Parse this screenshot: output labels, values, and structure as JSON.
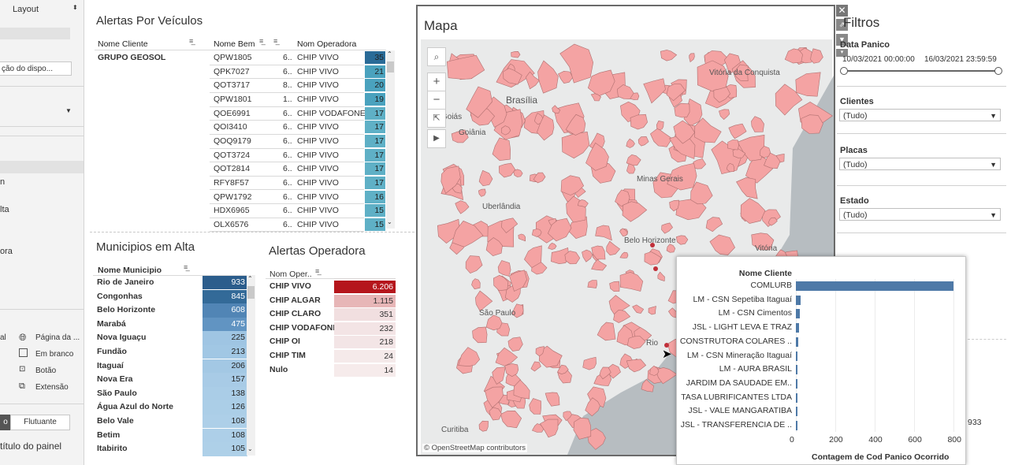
{
  "left_panel": {
    "layout_label": "Layout",
    "device_button": "ção do dispo...",
    "item_n": "n",
    "item_alta": "lta",
    "item_ora": "ora",
    "objects": [
      {
        "icon": "globe-icon",
        "label": "Página da ..."
      },
      {
        "icon": "blank-icon",
        "label": "Em branco"
      },
      {
        "icon": "button-icon",
        "label": "Botão"
      },
      {
        "icon": "extension-icon",
        "label": "Extensão"
      }
    ],
    "item_al": "al",
    "tiled_short": "o",
    "floating_label": "Flutuante",
    "panel_title": "título do painel"
  },
  "alertas_veiculos": {
    "title": "Alertas Por Veículos",
    "col_cliente": "Nome Cliente",
    "col_bem": "Nome Bem",
    "col_operadora": "Nom Operadora",
    "cliente": "GRUPO GEOSOL",
    "rows": [
      {
        "bem": "QPW1805",
        "c": "6..",
        "op": "CHIP VIVO",
        "n": "35"
      },
      {
        "bem": "QPK7027",
        "c": "6..",
        "op": "CHIP VIVO",
        "n": "21"
      },
      {
        "bem": "QOT3717",
        "c": "8..",
        "op": "CHIP VIVO",
        "n": "20"
      },
      {
        "bem": "QPW1801",
        "c": "1..",
        "op": "CHIP VIVO",
        "n": "19"
      },
      {
        "bem": "QOE6991",
        "c": "6..",
        "op": "CHIP VODAFONE",
        "n": "17"
      },
      {
        "bem": "QOI3410",
        "c": "6..",
        "op": "CHIP VIVO",
        "n": "17"
      },
      {
        "bem": "QOQ9179",
        "c": "6..",
        "op": "CHIP VIVO",
        "n": "17"
      },
      {
        "bem": "QOT3724",
        "c": "6..",
        "op": "CHIP VIVO",
        "n": "17"
      },
      {
        "bem": "QOT2814",
        "c": "6..",
        "op": "CHIP VIVO",
        "n": "17"
      },
      {
        "bem": "RFY8F57",
        "c": "6..",
        "op": "CHIP VIVO",
        "n": "17"
      },
      {
        "bem": "QPW1792",
        "c": "6..",
        "op": "CHIP VIVO",
        "n": "16"
      },
      {
        "bem": "HDX6965",
        "c": "6..",
        "op": "CHIP VIVO",
        "n": "15"
      },
      {
        "bem": "OLX6576",
        "c": "6..",
        "op": "CHIP VIVO",
        "n": "15"
      }
    ],
    "colors": {
      "top": "#2a6b97",
      "mid": "#4aa2be",
      "low": "#5fb0c6"
    }
  },
  "municipios": {
    "title": "Municipios em Alta",
    "col_nome": "Nome Municipio",
    "rows": [
      {
        "name": "Rio de Janeiro",
        "value": "933",
        "color": "#2b5d8c"
      },
      {
        "name": "Congonhas",
        "value": "845",
        "color": "#336a98"
      },
      {
        "name": "Belo Horizonte",
        "value": "608",
        "color": "#5185b5"
      },
      {
        "name": "Marabá",
        "value": "475",
        "color": "#6194c2"
      },
      {
        "name": "Nova Iguaçu",
        "value": "225",
        "color": "#9fc5e3"
      },
      {
        "name": "Fundão",
        "value": "213",
        "color": "#a1c7e4"
      },
      {
        "name": "Itaguaí",
        "value": "206",
        "color": "#a3c8e4"
      },
      {
        "name": "Nova Era",
        "value": "157",
        "color": "#a8cbe6"
      },
      {
        "name": "São Paulo",
        "value": "138",
        "color": "#aacde7"
      },
      {
        "name": "Água Azul do Norte",
        "value": "126",
        "color": "#abcee7"
      },
      {
        "name": "Belo Vale",
        "value": "108",
        "color": "#adcfe8"
      },
      {
        "name": "Betim",
        "value": "108",
        "color": "#adcfe8"
      },
      {
        "name": "Itabirito",
        "value": "105",
        "color": "#aed0e8"
      }
    ]
  },
  "operadora": {
    "title": "Alertas Operadora",
    "col_nome": "Nom Oper..",
    "rows": [
      {
        "name": "CHIP VIVO",
        "value": "6.206",
        "color": "#b5161c",
        "text": "#ffffff"
      },
      {
        "name": "CHIP ALGAR",
        "value": "1.115",
        "color": "#e7b6b7",
        "text": "#333333"
      },
      {
        "name": "CHIP CLARO",
        "value": "351",
        "color": "#f1dfe0",
        "text": "#333333"
      },
      {
        "name": "CHIP VODAFONE",
        "value": "232",
        "color": "#f3e4e5",
        "text": "#333333"
      },
      {
        "name": "CHIP OI",
        "value": "218",
        "color": "#f3e5e6",
        "text": "#333333"
      },
      {
        "name": "CHIP TIM",
        "value": "24",
        "color": "#f5eaea",
        "text": "#333333"
      },
      {
        "name": "Nulo",
        "value": "14",
        "color": "#f6ebeb",
        "text": "#333333"
      }
    ]
  },
  "map": {
    "title": "Mapa",
    "attribution": "© OpenStreetMap contributors",
    "places": [
      {
        "name": "Brasília"
      },
      {
        "name": "Goiás"
      },
      {
        "name": "Goiânia"
      },
      {
        "name": "Vitória da Conquista"
      },
      {
        "name": "Uberlândia"
      },
      {
        "name": "Minas Gerais"
      },
      {
        "name": "Belo Horizonte"
      },
      {
        "name": "São Paulo"
      },
      {
        "name": "Vitória"
      },
      {
        "name": "Rio"
      },
      {
        "name": "Curitiba"
      }
    ]
  },
  "filters": {
    "title": "Filtros",
    "date_label": "Data Panico",
    "date_start": "10/03/2021 00:00:00",
    "date_end": "16/03/2021 23:59:59",
    "clientes_label": "Clientes",
    "clientes_value": "(Tudo)",
    "placas_label": "Placas",
    "placas_value": "(Tudo)",
    "estado_label": "Estado",
    "estado_value": "(Tudo)",
    "hidden_value": "933"
  },
  "tooltip_chart": {
    "header": "Nome Cliente",
    "xlabel": "Contagem de Cod Panico Ocorrido",
    "ticks": [
      "0",
      "200",
      "400",
      "600",
      "800"
    ]
  },
  "chart_data": {
    "type": "bar",
    "orientation": "horizontal",
    "categories": [
      "COMLURB",
      "LM - CSN Sepetiba Itaguaí",
      "LM - CSN Cimentos",
      "JSL - LIGHT LEVA E TRAZ",
      "CONSTRUTORA COLARES ..",
      "LM - CSN Mineração Itaguaí",
      "LM - AURA BRASIL",
      "JARDIM DA SAUDADE EM..",
      "TASA LUBRIFICANTES LTDA",
      "JSL - VALE MANGARATIBA",
      "JSL - TRANSFERENCIA DE .."
    ],
    "values": [
      800,
      25,
      20,
      15,
      12,
      8,
      5,
      3,
      1,
      1,
      1
    ],
    "xlabel": "Contagem de Cod Panico Ocorrido",
    "ylabel": "Nome Cliente",
    "xlim": [
      0,
      850
    ],
    "grid": true
  }
}
